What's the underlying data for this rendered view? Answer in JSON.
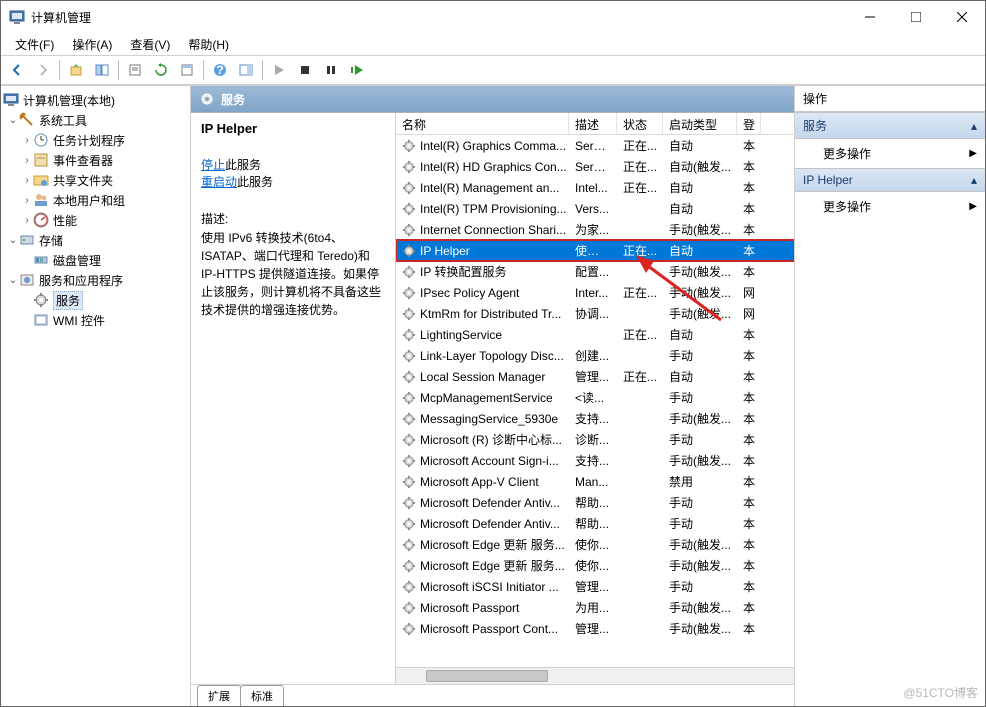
{
  "window": {
    "title": "计算机管理"
  },
  "menu": {
    "file": "文件(F)",
    "action": "操作(A)",
    "view": "查看(V)",
    "help": "帮助(H)"
  },
  "tree": {
    "root": "计算机管理(本地)",
    "sys_tools": "系统工具",
    "task_scheduler": "任务计划程序",
    "event_viewer": "事件查看器",
    "shared_folders": "共享文件夹",
    "local_users": "本地用户和组",
    "performance": "性能",
    "storage": "存储",
    "disk_mgmt": "磁盘管理",
    "services_apps": "服务和应用程序",
    "services": "服务",
    "wmi": "WMI 控件"
  },
  "center": {
    "header": "服务",
    "tabs": {
      "extended": "扩展",
      "standard": "标准"
    }
  },
  "detail": {
    "title": "IP Helper",
    "stop": "停止",
    "stop_suffix": "此服务",
    "restart": "重启动",
    "restart_suffix": "此服务",
    "desc_label": "描述:",
    "desc": "使用 IPv6 转换技术(6to4、ISATAP、端口代理和 Teredo)和 IP-HTTPS 提供隧道连接。如果停止该服务，则计算机将不具备这些技术提供的增强连接优势。"
  },
  "columns": {
    "name": "名称",
    "desc": "描述",
    "status": "状态",
    "startup": "启动类型",
    "logon": "登"
  },
  "services": [
    {
      "name": "Intel(R) Graphics Comma...",
      "desc": "Servi...",
      "status": "正在...",
      "start": "自动",
      "logon": "本"
    },
    {
      "name": "Intel(R) HD Graphics Con...",
      "desc": "Servi...",
      "status": "正在...",
      "start": "自动(触发...",
      "logon": "本"
    },
    {
      "name": "Intel(R) Management an...",
      "desc": "Intel...",
      "status": "正在...",
      "start": "自动",
      "logon": "本"
    },
    {
      "name": "Intel(R) TPM Provisioning...",
      "desc": "Vers...",
      "status": "",
      "start": "自动",
      "logon": "本"
    },
    {
      "name": "Internet Connection Shari...",
      "desc": "为家...",
      "status": "",
      "start": "手动(触发...",
      "logon": "本"
    },
    {
      "name": "IP Helper",
      "desc": "使用 ...",
      "status": "正在...",
      "start": "自动",
      "logon": "本",
      "selected": true
    },
    {
      "name": "IP 转换配置服务",
      "desc": "配置...",
      "status": "",
      "start": "手动(触发...",
      "logon": "本"
    },
    {
      "name": "IPsec Policy Agent",
      "desc": "Inter...",
      "status": "正在...",
      "start": "手动(触发...",
      "logon": "网"
    },
    {
      "name": "KtmRm for Distributed Tr...",
      "desc": "协调...",
      "status": "",
      "start": "手动(触发...",
      "logon": "网"
    },
    {
      "name": "LightingService",
      "desc": "",
      "status": "正在...",
      "start": "自动",
      "logon": "本"
    },
    {
      "name": "Link-Layer Topology Disc...",
      "desc": "创建...",
      "status": "",
      "start": "手动",
      "logon": "本"
    },
    {
      "name": "Local Session Manager",
      "desc": "管理...",
      "status": "正在...",
      "start": "自动",
      "logon": "本"
    },
    {
      "name": "McpManagementService",
      "desc": "<读...",
      "status": "",
      "start": "手动",
      "logon": "本"
    },
    {
      "name": "MessagingService_5930e",
      "desc": "支持...",
      "status": "",
      "start": "手动(触发...",
      "logon": "本"
    },
    {
      "name": "Microsoft (R) 诊断中心标...",
      "desc": "诊断...",
      "status": "",
      "start": "手动",
      "logon": "本"
    },
    {
      "name": "Microsoft Account Sign-i...",
      "desc": "支持...",
      "status": "",
      "start": "手动(触发...",
      "logon": "本"
    },
    {
      "name": "Microsoft App-V Client",
      "desc": "Man...",
      "status": "",
      "start": "禁用",
      "logon": "本"
    },
    {
      "name": "Microsoft Defender Antiv...",
      "desc": "帮助...",
      "status": "",
      "start": "手动",
      "logon": "本"
    },
    {
      "name": "Microsoft Defender Antiv...",
      "desc": "帮助...",
      "status": "",
      "start": "手动",
      "logon": "本"
    },
    {
      "name": "Microsoft Edge 更新 服务...",
      "desc": "使你...",
      "status": "",
      "start": "手动(触发...",
      "logon": "本"
    },
    {
      "name": "Microsoft Edge 更新 服务...",
      "desc": "使你...",
      "status": "",
      "start": "手动(触发...",
      "logon": "本"
    },
    {
      "name": "Microsoft iSCSI Initiator ...",
      "desc": "管理...",
      "status": "",
      "start": "手动",
      "logon": "本"
    },
    {
      "name": "Microsoft Passport",
      "desc": "为用...",
      "status": "",
      "start": "手动(触发...",
      "logon": "本"
    },
    {
      "name": "Microsoft Passport Cont...",
      "desc": "管理...",
      "status": "",
      "start": "手动(触发...",
      "logon": "本"
    }
  ],
  "actions": {
    "header": "操作",
    "group1": "服务",
    "more": "更多操作",
    "group2": "IP Helper"
  },
  "watermark": "@51CTO博客"
}
